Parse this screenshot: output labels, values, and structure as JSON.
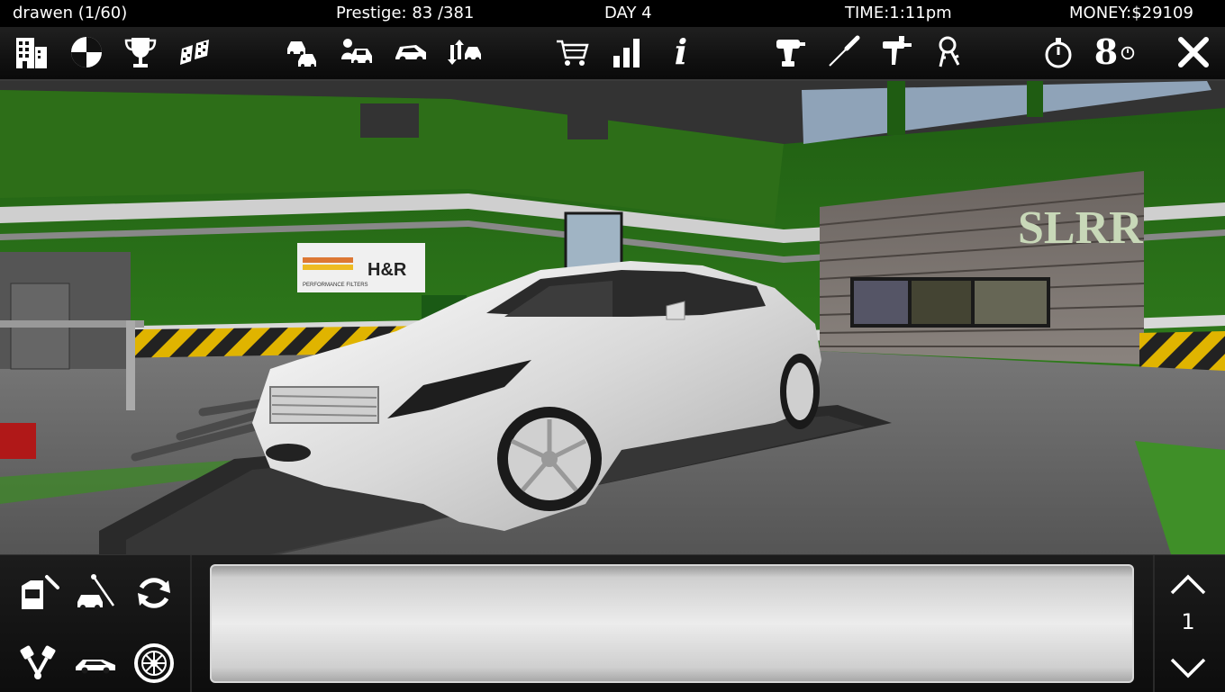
{
  "status": {
    "player": "drawen (1/60)",
    "prestige": "Prestige: 83 /381",
    "day": "DAY 4",
    "time": "TIME:1:11pm",
    "money": "MONEY:$29109"
  },
  "toolbar": {
    "left_icons": [
      "buildings-icon",
      "world-map-icon",
      "trophy-icon",
      "race-flags-icon"
    ],
    "car_icons": [
      "garage-cars-icon",
      "car-dealer-icon",
      "used-car-icon",
      "car-trade-icon"
    ],
    "info_icons": [
      "shopping-cart-icon",
      "stats-bars-icon",
      "info-icon"
    ],
    "tool_icons": [
      "drill-icon",
      "screwdriver-icon",
      "paint-gun-icon",
      "keys-icon"
    ],
    "right_icons": [
      "stopwatch-icon",
      "quarter-mile-timer-icon",
      "close-icon"
    ],
    "quarter_mile_glyph": "8"
  },
  "scene": {
    "garage_sign": "SLRR",
    "banner_text": "H&R",
    "banner_sub": "PERFORMANCE FILTERS"
  },
  "bottom": {
    "page_number": "1",
    "left_icons": [
      "door-repair-icon",
      "car-tune-icon",
      "refresh-icon",
      "engine-pistons-icon",
      "car-body-icon",
      "wheel-icon"
    ]
  },
  "colors": {
    "wall_green": "#2f7a1c",
    "accent_stripe": "#dcdcdc",
    "hazard_yellow": "#e0b400",
    "car_white": "#f2f2f2"
  }
}
